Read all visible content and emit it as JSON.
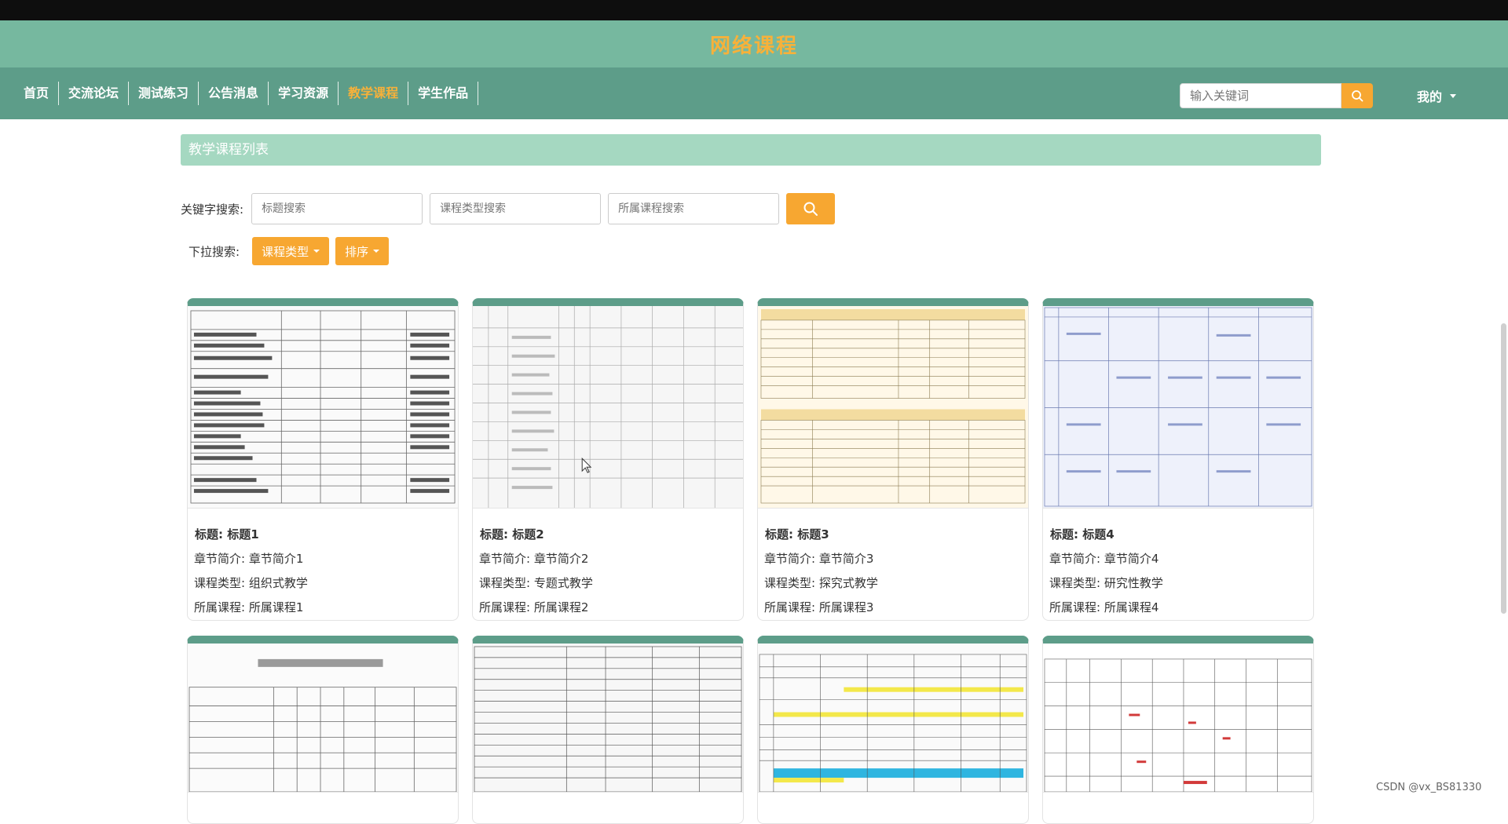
{
  "site": {
    "title": "网络课程"
  },
  "nav": {
    "items": [
      {
        "label": "首页"
      },
      {
        "label": "交流论坛"
      },
      {
        "label": "测试练习"
      },
      {
        "label": "公告消息"
      },
      {
        "label": "学习资源"
      },
      {
        "label": "教学课程",
        "active": true
      },
      {
        "label": "学生作品"
      }
    ],
    "search_placeholder": "输入关键词",
    "mine_label": "我的"
  },
  "section": {
    "title": "教学课程列表"
  },
  "search": {
    "label": "关键字搜索:",
    "title_placeholder": "标题搜索",
    "type_placeholder": "课程类型搜索",
    "course_placeholder": "所属课程搜索"
  },
  "dropdown": {
    "label": "下拉搜索:",
    "type_button": "课程类型",
    "sort_button": "排序"
  },
  "cards": [
    {
      "title": "标题: 标题1",
      "intro": "章节简介: 章节简介1",
      "type": "课程类型: 组织式教学",
      "course": "所属课程: 所属课程1"
    },
    {
      "title": "标题: 标题2",
      "intro": "章节简介: 章节简介2",
      "type": "课程类型: 专题式教学",
      "course": "所属课程: 所属课程2"
    },
    {
      "title": "标题: 标题3",
      "intro": "章节简介: 章节简介3",
      "type": "课程类型: 探究式教学",
      "course": "所属课程: 所属课程3"
    },
    {
      "title": "标题: 标题4",
      "intro": "章节简介: 章节简介4",
      "type": "课程类型: 研究性教学",
      "course": "所属课程: 所属课程4"
    }
  ],
  "watermark": "CSDN @vx_BS81330",
  "colors": {
    "nav": "#5d9d89",
    "titlebar": "#76b89f",
    "accent": "#f7a731",
    "section": "#a5d8c1"
  }
}
